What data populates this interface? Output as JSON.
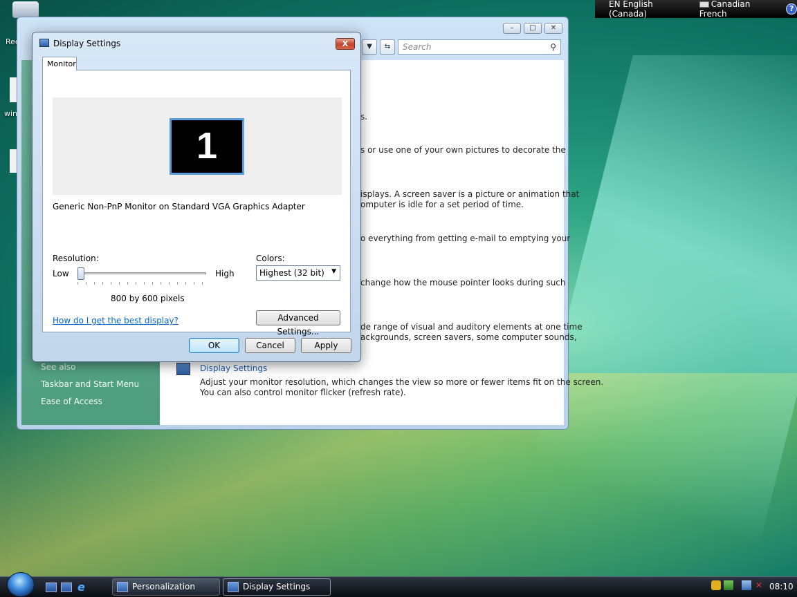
{
  "language_bar": {
    "input_language": "EN English (Canada)",
    "keyboard_layout": "Canadian French",
    "help_glyph": "?"
  },
  "desktop": {
    "recycle_label_fragment": "Rec",
    "icon_label_fragment": "win"
  },
  "personalization_window": {
    "search_placeholder": "Search",
    "sidebar": {
      "see_also": "See also",
      "links": [
        "Taskbar and Start Menu",
        "Ease of Access"
      ]
    },
    "content_lines": [
      "s.",
      "s or use one of your own pictures to decorate the",
      "isplays. A screen saver is a picture or animation that",
      "omputer is idle for a set period of time.",
      "o everything from getting e-mail to emptying your",
      "change how the mouse pointer looks during such",
      "de range of visual and auditory elements at one time",
      "ackgrounds, screen savers, some computer sounds,"
    ],
    "display_settings_link": "Display Settings",
    "display_settings_desc_1": "Adjust your monitor resolution, which changes the view so more or fewer items fit on the screen.",
    "display_settings_desc_2": "You can also control monitor flicker (refresh rate)."
  },
  "dialog": {
    "title": "Display Settings",
    "close_glyph": "X",
    "tab_label": "Monitor",
    "monitor_number": "1",
    "monitor_description": "Generic Non-PnP Monitor on Standard VGA Graphics Adapter",
    "resolution_label": "Resolution:",
    "slider_low": "Low",
    "slider_high": "High",
    "resolution_value": "800 by 600 pixels",
    "resolution_slider_position": 0.0,
    "colors_label": "Colors:",
    "colors_selected": "Highest (32 bit)",
    "advanced_button": "Advanced Settings...",
    "help_link": "How do I get the best display?",
    "ok_button": "OK",
    "cancel_button": "Cancel",
    "apply_button": "Apply"
  },
  "taskbar": {
    "tasks": [
      {
        "label": "Personalization"
      },
      {
        "label": "Display Settings"
      }
    ],
    "clock": "08:10"
  }
}
